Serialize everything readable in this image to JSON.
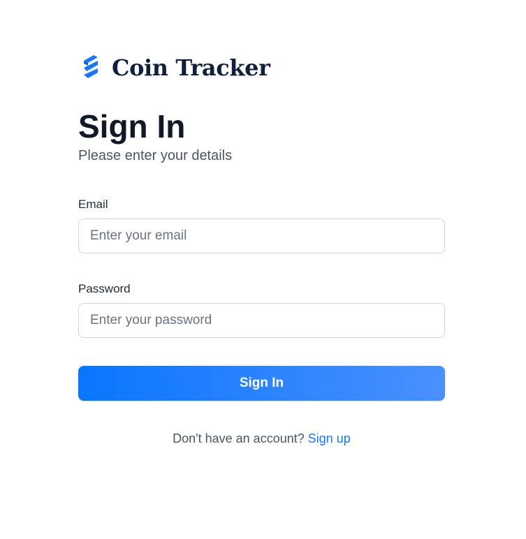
{
  "brand": {
    "name": "Coin Tracker",
    "logo_icon": "stacked-chevrons-logo",
    "logo_color": "#1677ff"
  },
  "header": {
    "title": "Sign In",
    "subtitle": "Please enter your details"
  },
  "form": {
    "email": {
      "label": "Email",
      "value": "",
      "placeholder": "Enter your email"
    },
    "password": {
      "label": "Password",
      "value": "",
      "placeholder": "Enter your password"
    },
    "submit_label": "Sign In"
  },
  "footer": {
    "prompt": "Don't have an account?",
    "link_label": "Sign up"
  },
  "colors": {
    "accent": "#0a76ff",
    "accent_gradient_end": "#4a90ff",
    "title": "#111827",
    "muted": "#4b5563",
    "border": "#d1d5db"
  }
}
